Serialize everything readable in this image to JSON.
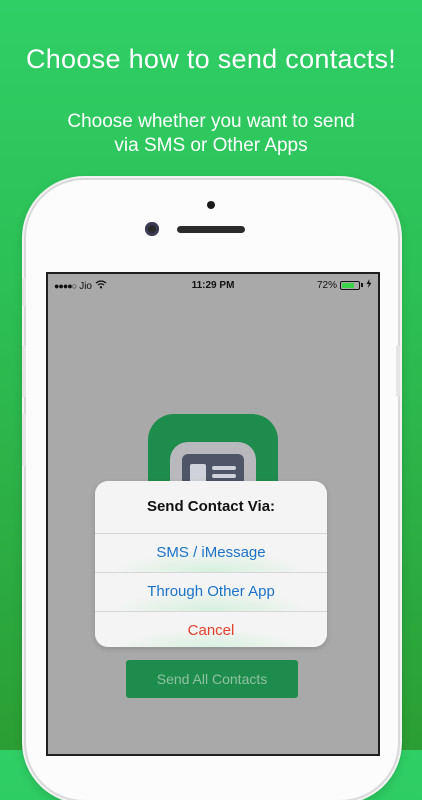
{
  "headline": "Choose how to send contacts!",
  "subline": {
    "line1": "Choose whether you want to send",
    "line2": "via SMS or Other Apps"
  },
  "status_bar": {
    "signal_dots": "●●●●○",
    "carrier": "Jio",
    "wifi_icon": "wifi-icon",
    "time": "11:29 PM",
    "battery_percent": "72%",
    "battery_level": 0.72,
    "battery_color": "#3ad34a"
  },
  "app": {
    "send_all_label": "Send All Contacts",
    "accent": "#1e8c4c"
  },
  "action_sheet": {
    "title": "Send Contact Via:",
    "options": [
      "SMS / iMessage",
      "Through Other App"
    ],
    "cancel": "Cancel",
    "option_color": "#1a73c9",
    "cancel_color": "#e2402a"
  }
}
